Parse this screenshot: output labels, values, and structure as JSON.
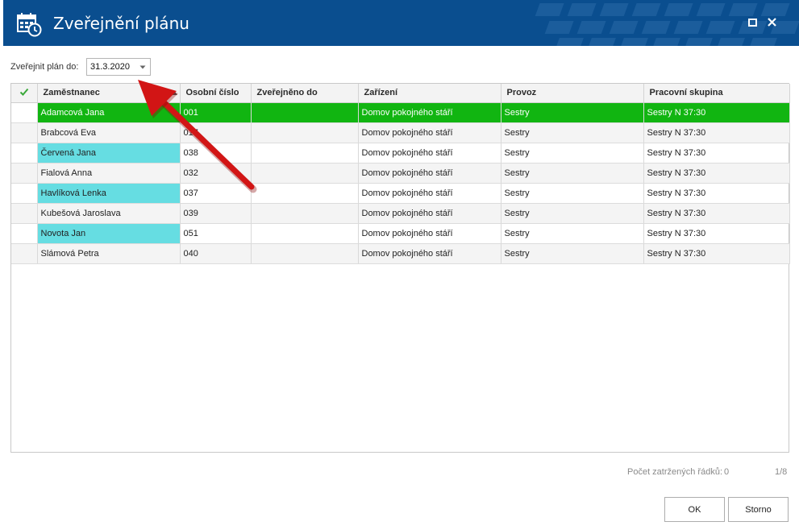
{
  "window": {
    "title": "Zveřejnění plánu",
    "icon": "calendar-clock-icon",
    "header_color": "#0a4e8f"
  },
  "filter": {
    "label": "Zveřejnit plán do:",
    "date_value": "31.3.2020"
  },
  "grid": {
    "columns": [
      "",
      "Zaměstnanec",
      "Osobní číslo",
      "Zveřejněno do",
      "Zařízení",
      "Provoz",
      "Pracovní skupina"
    ],
    "rows": [
      {
        "name": "Adamcová Jana",
        "number": "001",
        "published": "",
        "facility": "Domov pokojného stáří",
        "operation": "Sestry",
        "group": "Sestry N 37:30"
      },
      {
        "name": "Brabcová Eva",
        "number": "017",
        "published": "",
        "facility": "Domov pokojného stáří",
        "operation": "Sestry",
        "group": "Sestry N 37:30"
      },
      {
        "name": "Červená Jana",
        "number": "038",
        "published": "",
        "facility": "Domov pokojného stáří",
        "operation": "Sestry",
        "group": "Sestry N 37:30"
      },
      {
        "name": "Fialová Anna",
        "number": "032",
        "published": "",
        "facility": "Domov pokojného stáří",
        "operation": "Sestry",
        "group": "Sestry N 37:30"
      },
      {
        "name": "Havlíková Lenka",
        "number": "037",
        "published": "",
        "facility": "Domov pokojného stáří",
        "operation": "Sestry",
        "group": "Sestry N 37:30"
      },
      {
        "name": "Kubešová Jaroslava",
        "number": "039",
        "published": "",
        "facility": "Domov pokojného stáří",
        "operation": "Sestry",
        "group": "Sestry N 37:30"
      },
      {
        "name": "Novota Jan",
        "number": "051",
        "published": "",
        "facility": "Domov pokojného stáří",
        "operation": "Sestry",
        "group": "Sestry N 37:30"
      },
      {
        "name": "Slámová Petra",
        "number": "040",
        "published": "",
        "facility": "Domov pokojného stáří",
        "operation": "Sestry",
        "group": "Sestry N 37:30"
      }
    ],
    "selected_row_color": "#11b511",
    "employee_cell_color": "#66dde2"
  },
  "footer": {
    "checked_count_label": "Počet zatržených řádků:",
    "checked_count": "0",
    "pager": "1/8",
    "ok_label": "OK",
    "cancel_label": "Storno"
  }
}
